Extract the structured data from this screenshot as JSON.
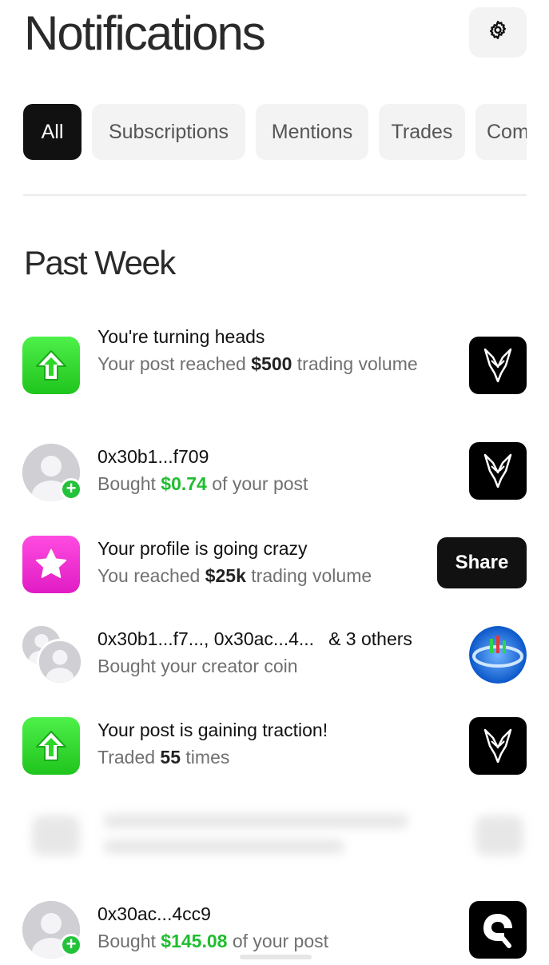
{
  "header": {
    "title": "Notifications",
    "settings_icon": "gear-icon"
  },
  "tabs": [
    {
      "label": "All",
      "active": true
    },
    {
      "label": "Subscriptions",
      "active": false
    },
    {
      "label": "Mentions",
      "active": false
    },
    {
      "label": "Trades",
      "active": false
    },
    {
      "label": "Com",
      "active": false
    }
  ],
  "section": {
    "title": "Past Week"
  },
  "notifications": [
    {
      "icon": "up-arrow-icon",
      "title": "You're turning heads",
      "body_prefix": "Your post reached ",
      "body_value": "$500",
      "body_suffix": " trading volume",
      "thumb": "post-thumbnail"
    },
    {
      "icon": "avatar",
      "title": "0x30b1...f709",
      "body_prefix": "Bought ",
      "body_value": "$0.74",
      "body_suffix": " of your post",
      "thumb": "post-thumbnail"
    },
    {
      "icon": "star-icon",
      "title": "Your profile is going crazy",
      "body_prefix": "You reached ",
      "body_value": "$25k",
      "body_suffix": " trading volume",
      "action_label": "Share"
    },
    {
      "icon": "avatar-stack",
      "title_a": "0x30b1...f7...",
      "title_sep": ", ",
      "title_b": "0x30ac...4...",
      "title_extra": "& 3 others",
      "body": "Bought your creator coin",
      "thumb": "creator-coin-thumbnail"
    },
    {
      "icon": "up-arrow-icon",
      "title": "Your post is gaining traction!",
      "body_prefix": "Traded ",
      "body_value": "55",
      "body_suffix": " times",
      "thumb": "post-thumbnail"
    },
    {
      "icon": "avatar",
      "title": "0x30ac...4cc9",
      "body_prefix": "Bought ",
      "body_value": "$145.08",
      "body_suffix": " of your post",
      "thumb": "post-thumbnail"
    }
  ],
  "colors": {
    "accent_green": "#1fbd2f",
    "icon_green": "#2ad826",
    "icon_pink": "#f02ad6",
    "dark": "#111111"
  }
}
